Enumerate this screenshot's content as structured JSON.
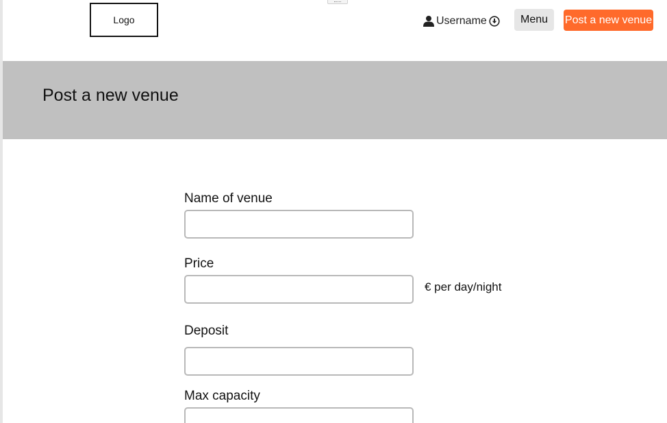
{
  "header": {
    "logo_text": "Logo",
    "username": "Username",
    "menu_label": "Menu",
    "post_venue_label": "Post a new venue"
  },
  "banner": {
    "title": "Post a new venue"
  },
  "form": {
    "name": {
      "label": "Name of venue",
      "value": ""
    },
    "price": {
      "label": "Price",
      "value": "",
      "suffix": "€ per day/night"
    },
    "deposit": {
      "label": "Deposit",
      "value": ""
    },
    "capacity": {
      "label": "Max capacity",
      "value": ""
    }
  },
  "colors": {
    "accent": "#ff6a2b",
    "banner_bg": "#c0c0c0",
    "menu_bg": "#e6e6e6"
  },
  "icons": {
    "user": "user-icon",
    "dropdown": "circle-arrow-down-icon"
  }
}
